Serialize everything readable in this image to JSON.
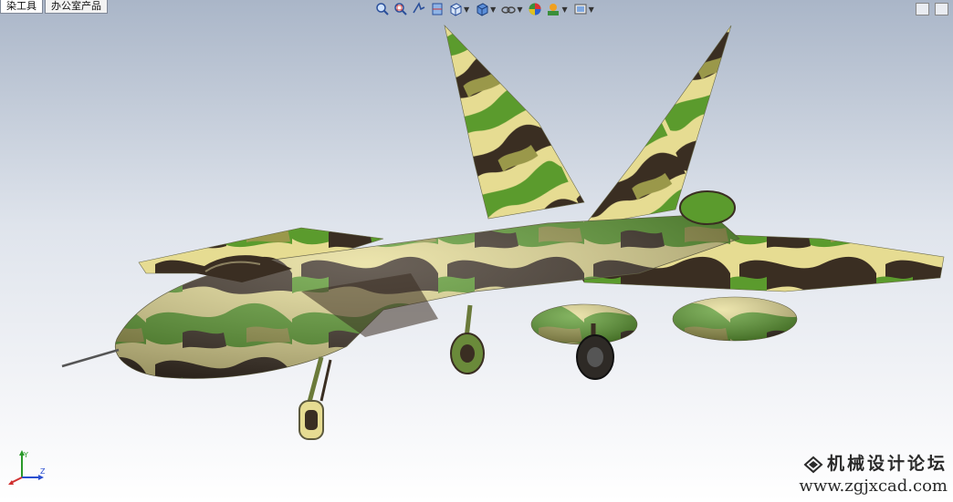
{
  "tabs": [
    {
      "label": "染工具",
      "active": true
    },
    {
      "label": "办公室产品",
      "active": false
    }
  ],
  "toolbar": {
    "icons": [
      "zoom-to-fit-icon",
      "zoom-area-icon",
      "previous-view-icon",
      "section-view-icon",
      "view-orientation-icon",
      "display-style-icon",
      "hide-show-items-icon",
      "edit-appearance-icon",
      "apply-scene-icon",
      "view-settings-icon"
    ]
  },
  "model": {
    "name": "camouflage-fighter-jet"
  },
  "watermark": {
    "title": "机械设计论坛",
    "url": "www.zgjxcad.com"
  },
  "triad": {
    "x": "X",
    "y": "Y",
    "z": "Z"
  },
  "colors": {
    "camo_light": "#e8dc8e",
    "camo_green": "#5a9a2c",
    "camo_dark": "#3b2f22",
    "camo_olive": "#9c9a4a"
  }
}
